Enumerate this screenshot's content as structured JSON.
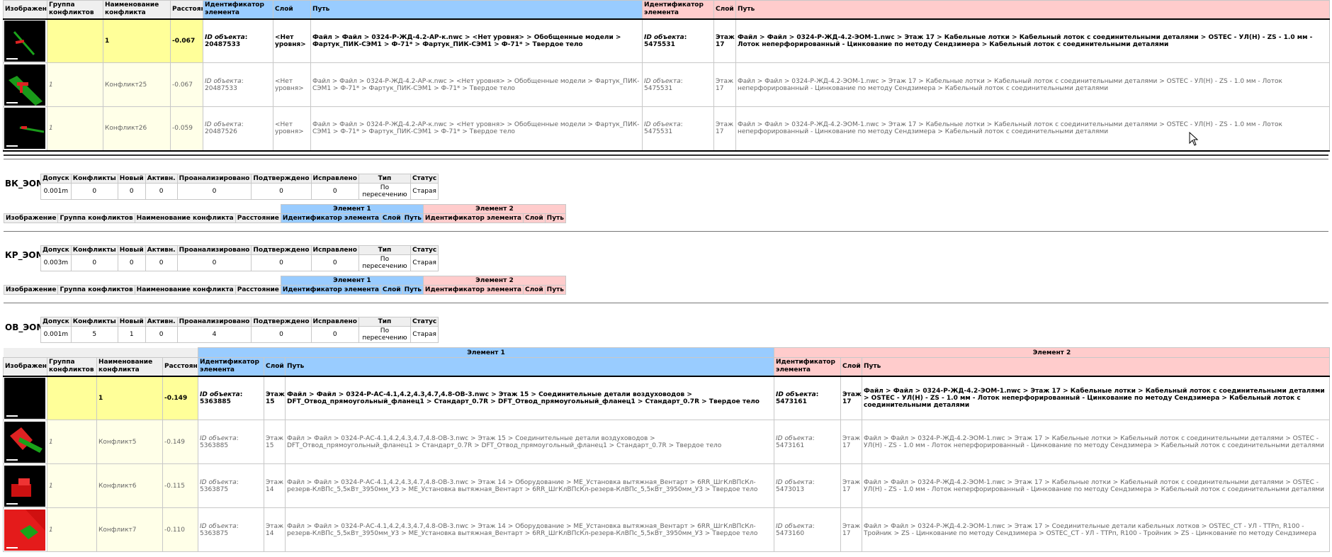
{
  "headers": {
    "image": "Изображение",
    "group": "Группа конфликтов",
    "name": "Наименование конфликта",
    "distance": "Расстояние",
    "id": "Идентификатор элемента",
    "layer": "Слой",
    "path": "Путь",
    "element1": "Элемент 1",
    "element2": "Элемент 2"
  },
  "stats_headers": [
    "Допуск",
    "Конфликты",
    "Новый",
    "Активн.",
    "Проанализировано",
    "Подтверждено",
    "Исправлено",
    "Тип",
    "Статус"
  ],
  "id_label": "ID объекта",
  "top_table": {
    "rows": [
      {
        "group": "",
        "name": "1",
        "distance": "-0.067",
        "id1": "20487533",
        "layer1": "<Нет уровня>",
        "path1": "Файл > Файл > 0324-Р-ЖД-4.2-АР-к.nwc > <Нет уровня> > Обобщенные модели > Фартук_ПИК-СЭМ1 > Ф-71* > Фартук_ПИК-СЭМ1 > Ф-71* > Твердое тело",
        "id2": "5475531",
        "layer2": "Этаж 17",
        "path2": "Файл > Файл > 0324-Р-ЖД-4.2-ЭОМ-1.nwc > Этаж 17 > Кабельные лотки > Кабельный лоток с соединительными деталями > OSTEC - УЛ(Н) - ZS - 1.0 мм - Лоток неперфорированный - Цинкование по методу Сендзимера > Кабельный лоток с соединительными деталями"
      },
      {
        "group": "1",
        "name": "Конфликт25",
        "distance": "-0.067",
        "id1": "20487533",
        "layer1": "<Нет уровня>",
        "path1": "Файл > Файл > 0324-Р-ЖД-4.2-АР-к.nwc > <Нет уровня> > Обобщенные модели > Фартук_ПИК-СЭМ1 > Ф-71* > Фартук_ПИК-СЭМ1 > Ф-71* > Твердое тело",
        "id2": "5475531",
        "layer2": "Этаж 17",
        "path2": "Файл > Файл > 0324-Р-ЖД-4.2-ЭОМ-1.nwc > Этаж 17 > Кабельные лотки > Кабельный лоток с соединительными деталями > OSTEC - УЛ(Н) - ZS - 1.0 мм - Лоток неперфорированный - Цинкование по методу Сендзимера > Кабельный лоток с соединительными деталями"
      },
      {
        "group": "1",
        "name": "Конфликт26",
        "distance": "-0.059",
        "id1": "20487526",
        "layer1": "<Нет уровня>",
        "path1": "Файл > Файл > 0324-Р-ЖД-4.2-АР-к.nwc > <Нет уровня> > Обобщенные модели > Фартук_ПИК-СЭМ1 > Ф-71* > Фартук_ПИК-СЭМ1 > Ф-71* > Твердое тело",
        "id2": "5475531",
        "layer2": "Этаж 17",
        "path2": "Файл > Файл > 0324-Р-ЖД-4.2-ЭОМ-1.nwc > Этаж 17 > Кабельные лотки > Кабельный лоток с соединительными деталями > OSTEC - УЛ(Н) - ZS - 1.0 мм - Лоток неперфорированный - Цинкование по методу Сендзимера > Кабельный лоток с соединительными деталями"
      }
    ]
  },
  "sections": [
    {
      "title": "ВК_ЭОМ",
      "stats": [
        "0.001m",
        "0",
        "0",
        "0",
        "0",
        "0",
        "0",
        "По пересечению",
        "Старая"
      ]
    },
    {
      "title": "КР_ЭОМ",
      "stats": [
        "0.003m",
        "0",
        "0",
        "0",
        "0",
        "0",
        "0",
        "По пересечению",
        "Старая"
      ]
    },
    {
      "title": "ОВ_ЭОМ",
      "stats": [
        "0.001m",
        "5",
        "1",
        "0",
        "4",
        "0",
        "0",
        "По пересечению",
        "Старая"
      ]
    }
  ],
  "ov_table": {
    "rows": [
      {
        "group": "",
        "name": "1",
        "distance": "-0.149",
        "id1": "5363885",
        "layer1": "Этаж 15",
        "path1": "Файл > Файл > 0324-Р-АС-4.1,4.2,4.3,4.7,4.8-ОВ-3.nwc > Этаж 15 > Соединительные детали воздуховодов > DFT_Отвод_прямоугольный_фланец1 > Стандарт_0.7R > DFT_Отвод_прямоугольный_фланец1 > Стандарт_0.7R > Твердое тело",
        "id2": "5473161",
        "layer2": "Этаж 17",
        "path2": "Файл > Файл > 0324-Р-ЖД-4.2-ЭОМ-1.nwc > Этаж 17 > Кабельные лотки > Кабельный лоток с соединительными деталями > OSTEC - УЛ(Н) - ZS - 1.0 мм - Лоток неперфорированный - Цинкование по методу Сендзимера > Кабельный лоток с соединительными деталями"
      },
      {
        "group": "1",
        "name": "Конфликт5",
        "distance": "-0.149",
        "id1": "5363885",
        "layer1": "Этаж 15",
        "path1": "Файл > Файл > 0324-Р-АС-4.1,4.2,4.3,4.7,4.8-ОВ-3.nwc > Этаж 15 > Соединительные детали воздуховодов > DFT_Отвод_прямоугольный_фланец1 > Стандарт_0.7R > DFT_Отвод_прямоугольный_фланец1 > Стандарт_0.7R > Твердое тело",
        "id2": "5473161",
        "layer2": "Этаж 17",
        "path2": "Файл > Файл > 0324-Р-ЖД-4.2-ЭОМ-1.nwc > Этаж 17 > Кабельные лотки > Кабельный лоток с соединительными деталями > OSTEC - УЛ(Н) - ZS - 1.0 мм - Лоток неперфорированный - Цинкование по методу Сендзимера > Кабельный лоток с соединительными деталями"
      },
      {
        "group": "1",
        "name": "Конфликт6",
        "distance": "-0.115",
        "id1": "5363875",
        "layer1": "Этаж 14",
        "path1": "Файл > Файл > 0324-Р-АС-4.1,4.2,4.3,4.7,4.8-ОВ-3.nwc > Этаж 14 > Оборудование > ME_Установка вытяжная_Вентарт > 6RR_ШгКлВПсКл-резерв-КлВПс_5,5кВт_3950мм_У3 > ME_Установка вытяжная_Вентарт > 6RR_ШгКлВПсКл-резерв-КлВПс_5,5кВт_3950мм_У3 > Твердое тело",
        "id2": "5473013",
        "layer2": "Этаж 17",
        "path2": "Файл > Файл > 0324-Р-ЖД-4.2-ЭОМ-1.nwc > Этаж 17 > Кабельные лотки > Кабельный лоток с соединительными деталями > OSTEC - УЛ(Н) - ZS - 1.0 мм - Лоток неперфорированный - Цинкование по методу Сендзимера > Кабельный лоток с соединительными деталями"
      },
      {
        "group": "1",
        "name": "Конфликт7",
        "distance": "-0.110",
        "id1": "5363875",
        "layer1": "Этаж 14",
        "path1": "Файл > Файл > 0324-Р-АС-4.1,4.2,4.3,4.7,4.8-ОВ-3.nwc > Этаж 14 > Оборудование > ME_Установка вытяжная_Вентарт > 6RR_ШгКлВПсКл-резерв-КлВПс_5,5кВт_3950мм_У3 > ME_Установка вытяжная_Вентарт > 6RR_ШгКлВПсКл-резерв-КлВПс_5,5кВт_3950мм_У3 > Твердое тело",
        "id2": "5473160",
        "layer2": "Этаж 17",
        "path2": "Файл > Файл > 0324-Р-ЖД-4.2-ЭОМ-1.nwc > Этаж 17 > Соединительные детали кабельных лотков > OSTEC_CT - УЛ - ТТРп, R100 - Тройник > ZS - Цинкование по методу Сендзимера > OSTEC_CT - УЛ - ТТРп, R100 - Тройник > ZS - Цинкование по методу Сендзимера"
      }
    ]
  }
}
